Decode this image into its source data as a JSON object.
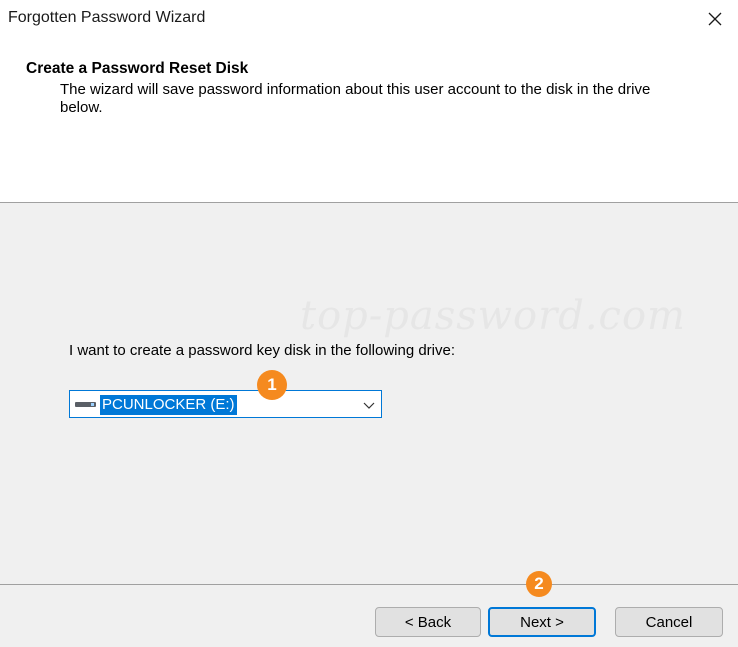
{
  "window": {
    "title": "Forgotten Password Wizard",
    "close_icon": "close-icon"
  },
  "header": {
    "title": "Create a Password Reset Disk",
    "description": "The wizard will save password information about this user account to the disk in the drive below."
  },
  "watermark": "top-password.com",
  "main": {
    "prompt": "I want to create a password key disk in the following drive:",
    "drive_select": {
      "selected_value": "PCUNLOCKER (E:)",
      "icon": "drive-icon"
    }
  },
  "annotations": {
    "step1": "1",
    "step2": "2",
    "color": "#f58a1f"
  },
  "buttons": {
    "back": "< Back",
    "next": "Next >",
    "cancel": "Cancel"
  },
  "colors": {
    "accent": "#0078d7",
    "background": "#f0f0f0"
  }
}
